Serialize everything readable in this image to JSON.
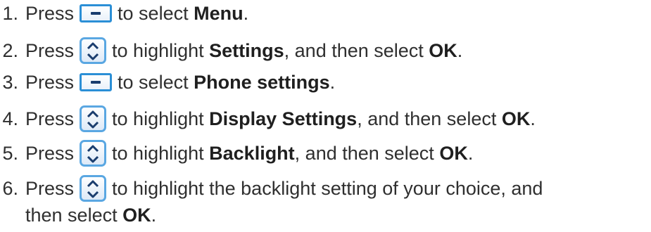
{
  "steps": [
    {
      "num": "1.",
      "press": "Press",
      "icon": "softkey-icon",
      "text": "to select ",
      "bold1": "Menu",
      "mid": ".",
      "bold2": "",
      "end": ""
    },
    {
      "num": "2.",
      "press": "Press",
      "icon": "navigation-key-icon",
      "text": "to highlight ",
      "bold1": "Settings",
      "mid": ", and then select ",
      "bold2": "OK",
      "end": "."
    },
    {
      "num": "3.",
      "press": "Press",
      "icon": "softkey-icon",
      "text": "to select ",
      "bold1": "Phone settings",
      "mid": ".",
      "bold2": "",
      "end": ""
    },
    {
      "num": "4.",
      "press": "Press",
      "icon": "navigation-key-icon",
      "text": "to highlight ",
      "bold1": "Display Settings",
      "mid": ", and then select ",
      "bold2": "OK",
      "end": "."
    },
    {
      "num": "5.",
      "press": "Press",
      "icon": "navigation-key-icon",
      "text": "to highlight ",
      "bold1": "Backlight",
      "mid": ", and then select ",
      "bold2": "OK",
      "end": "."
    },
    {
      "num": "6.",
      "press": "Press",
      "icon": "navigation-key-icon",
      "text": "to highlight the backlight setting of your choice, and",
      "bold1": "",
      "mid": "",
      "bold2": "",
      "end": "",
      "continuation": {
        "text": "then select ",
        "bold": "OK",
        "end": "."
      }
    }
  ],
  "colors": {
    "text": "#2f2f2f",
    "icon_border": "#2b8fd6",
    "icon_glyph": "#1a3d6e"
  }
}
